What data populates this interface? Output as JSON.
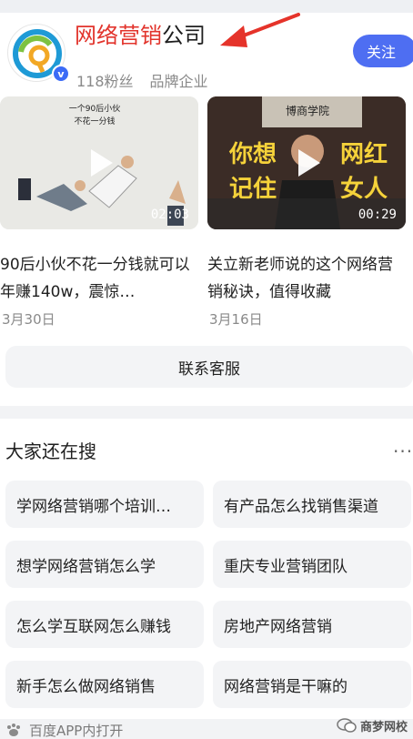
{
  "account": {
    "name_highlight": "网络营销",
    "name_rest": "公司",
    "fans": "118粉丝",
    "type": "品牌企业",
    "follow_label": "关注",
    "verified_mark": "v"
  },
  "videos": [
    {
      "duration": "02:03",
      "title": "90后小伙不花一分钱就可以年赚140w，震惊…",
      "date": "3月30日",
      "thumb_caption_1": "一个90后小伙",
      "thumb_caption_2": "不花一分钱"
    },
    {
      "duration": "00:29",
      "title": "关立新老师说的这个网络营销秘诀，值得收藏",
      "date": "3月16日",
      "thumb_text_left": "你想",
      "thumb_text_left2": "记住",
      "thumb_text_right": "网红",
      "thumb_text_right2": "女人",
      "thumb_sign": "博商学院"
    }
  ],
  "contact_label": "联系客服",
  "related": {
    "title": "大家还在搜",
    "more": "···",
    "items": [
      "学网络营销哪个培训…",
      "有产品怎么找销售渠道",
      "想学网络营销怎么学",
      "重庆专业营销团队",
      "怎么学互联网怎么赚钱",
      "房地产网络营销",
      "新手怎么做网络销售",
      "网络营销是干嘛的"
    ]
  },
  "footer": {
    "open_app": "百度APP内打开",
    "watermark": "商梦网校"
  },
  "colors": {
    "accent": "#4e6ef2",
    "highlight": "#e2342c",
    "arrow": "#e5332a"
  }
}
